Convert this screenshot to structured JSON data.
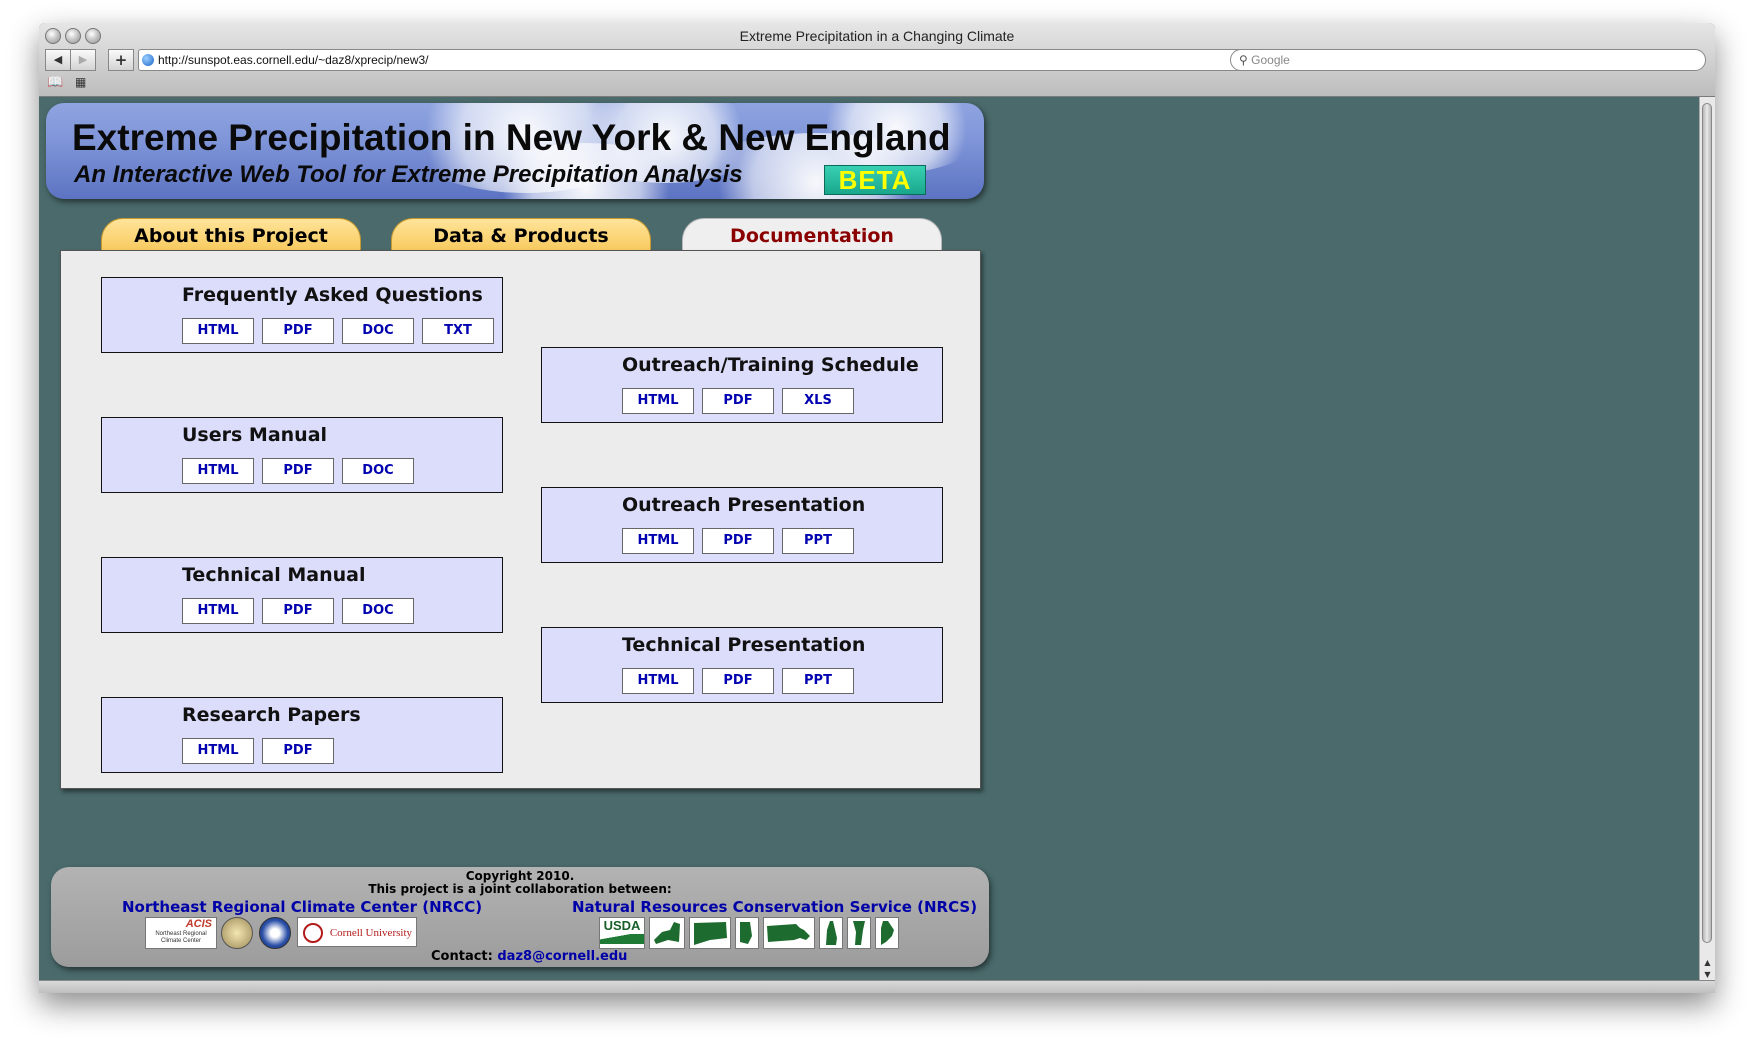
{
  "window": {
    "title": "Extreme Precipitation in a Changing Climate",
    "url": "http://sunspot.eas.cornell.edu/~daz8/xprecip/new3/",
    "search_placeholder": "Google"
  },
  "banner": {
    "title": "Extreme Precipitation in New York & New England",
    "subtitle": "An Interactive Web Tool for Extreme Precipitation Analysis",
    "badge": "BETA"
  },
  "tabs": [
    {
      "label": "About this Project",
      "active": false
    },
    {
      "label": "Data & Products",
      "active": false
    },
    {
      "label": "Documentation",
      "active": true
    }
  ],
  "docs": [
    {
      "title": "Frequently Asked Questions",
      "formats": [
        "HTML",
        "PDF",
        "DOC",
        "TXT"
      ]
    },
    {
      "title": "Users Manual",
      "formats": [
        "HTML",
        "PDF",
        "DOC"
      ]
    },
    {
      "title": "Technical Manual",
      "formats": [
        "HTML",
        "PDF",
        "DOC"
      ]
    },
    {
      "title": "Research Papers",
      "formats": [
        "HTML",
        "PDF"
      ]
    },
    {
      "title": "Outreach/Training Schedule",
      "formats": [
        "HTML",
        "PDF",
        "XLS"
      ]
    },
    {
      "title": "Outreach Presentation",
      "formats": [
        "HTML",
        "PDF",
        "PPT"
      ]
    },
    {
      "title": "Technical Presentation",
      "formats": [
        "HTML",
        "PDF",
        "PPT"
      ]
    }
  ],
  "footer": {
    "copyright": "Copyright 2010.",
    "collab": "This project is a joint collaboration between:",
    "org_left": "Northeast Regional Climate Center (NRCC)",
    "org_right": "Natural Resources Conservation Service (NRCS)",
    "logo_acis": "ACIS",
    "logo_acis_caption": "Northeast Regional Climate Center",
    "logo_cornell": "Cornell University",
    "logo_usda": "USDA",
    "contact_label": "Contact:",
    "contact_email": "daz8@cornell.edu"
  },
  "colors": {
    "page_bg": "#4a6a6b",
    "active_tab_text": "#8b0000",
    "link_blue": "#0000b0",
    "beta_text": "#ffff00"
  }
}
